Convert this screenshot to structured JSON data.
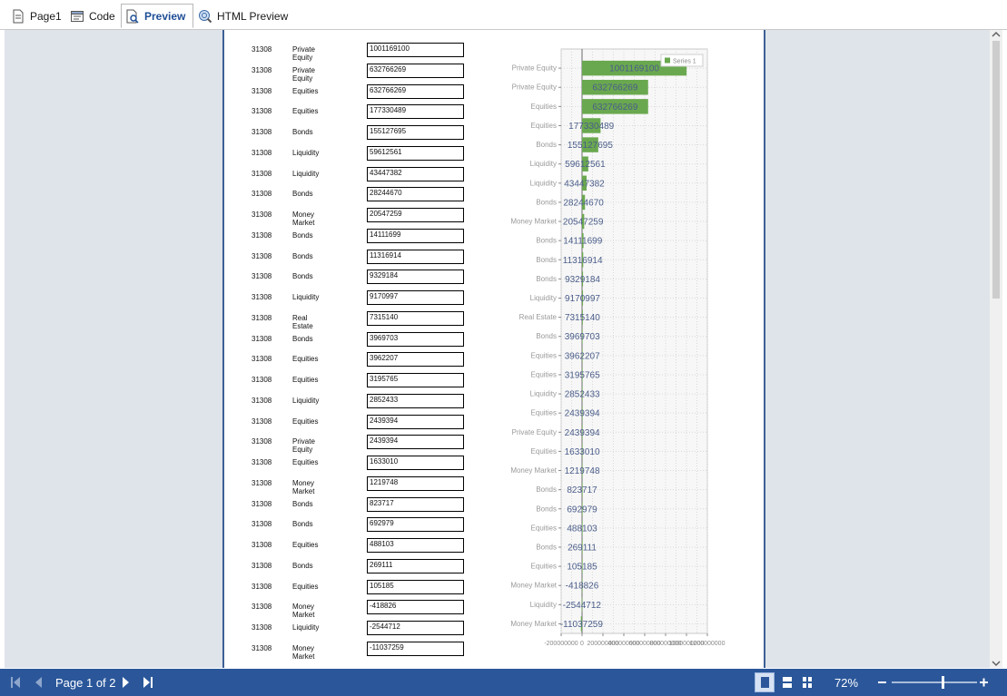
{
  "tabs": [
    {
      "label": "Page1",
      "icon": "page-icon"
    },
    {
      "label": "Code",
      "icon": "code-icon"
    },
    {
      "label": "Preview",
      "icon": "preview-icon",
      "active": true
    },
    {
      "label": "HTML Preview",
      "icon": "html-preview-icon"
    }
  ],
  "report": {
    "rows": [
      {
        "id": "31308",
        "category": "Private Equity",
        "value": "1001169100"
      },
      {
        "id": "31308",
        "category": "Private Equity",
        "value": "632766269"
      },
      {
        "id": "31308",
        "category": "Equities",
        "value": "632766269"
      },
      {
        "id": "31308",
        "category": "Equities",
        "value": "177330489"
      },
      {
        "id": "31308",
        "category": "Bonds",
        "value": "155127695"
      },
      {
        "id": "31308",
        "category": "Liquidity",
        "value": "59612561"
      },
      {
        "id": "31308",
        "category": "Liquidity",
        "value": "43447382"
      },
      {
        "id": "31308",
        "category": "Bonds",
        "value": "28244670"
      },
      {
        "id": "31308",
        "category": "Money Market",
        "value": "20547259"
      },
      {
        "id": "31308",
        "category": "Bonds",
        "value": "14111699"
      },
      {
        "id": "31308",
        "category": "Bonds",
        "value": "11316914"
      },
      {
        "id": "31308",
        "category": "Bonds",
        "value": "9329184"
      },
      {
        "id": "31308",
        "category": "Liquidity",
        "value": "9170997"
      },
      {
        "id": "31308",
        "category": "Real Estate",
        "value": "7315140"
      },
      {
        "id": "31308",
        "category": "Bonds",
        "value": "3969703"
      },
      {
        "id": "31308",
        "category": "Equities",
        "value": "3962207"
      },
      {
        "id": "31308",
        "category": "Equities",
        "value": "3195765"
      },
      {
        "id": "31308",
        "category": "Liquidity",
        "value": "2852433"
      },
      {
        "id": "31308",
        "category": "Equities",
        "value": "2439394"
      },
      {
        "id": "31308",
        "category": "Private Equity",
        "value": "2439394"
      },
      {
        "id": "31308",
        "category": "Equities",
        "value": "1633010"
      },
      {
        "id": "31308",
        "category": "Money Market",
        "value": "1219748"
      },
      {
        "id": "31308",
        "category": "Bonds",
        "value": "823717"
      },
      {
        "id": "31308",
        "category": "Bonds",
        "value": "692979"
      },
      {
        "id": "31308",
        "category": "Equities",
        "value": "488103"
      },
      {
        "id": "31308",
        "category": "Bonds",
        "value": "269111"
      },
      {
        "id": "31308",
        "category": "Equities",
        "value": "105185"
      },
      {
        "id": "31308",
        "category": "Money Market",
        "value": "-418826"
      },
      {
        "id": "31308",
        "category": "Liquidity",
        "value": "-2544712"
      },
      {
        "id": "31308",
        "category": "Money Market",
        "value": "-11037259"
      }
    ]
  },
  "chart_data": {
    "type": "bar",
    "orientation": "horizontal",
    "categories": [
      "Money Market",
      "Liquidity",
      "Money Market",
      "Equities",
      "Bonds",
      "Equities",
      "Bonds",
      "Bonds",
      "Money Market",
      "Equities",
      "Private Equity",
      "Equities",
      "Liquidity",
      "Equities",
      "Equities",
      "Bonds",
      "Real Estate",
      "Liquidity",
      "Bonds",
      "Bonds",
      "Bonds",
      "Money Market",
      "Bonds",
      "Liquidity",
      "Liquidity",
      "Bonds",
      "Equities",
      "Equities",
      "Private Equity",
      "Private Equity"
    ],
    "series": [
      {
        "name": "Series 1",
        "color": "#6aa84f",
        "values": [
          -11037259,
          -2544712,
          -418826,
          105185,
          269111,
          488103,
          692979,
          823717,
          1219748,
          1633010,
          2439394,
          2439394,
          2852433,
          3195765,
          3962207,
          3969703,
          7315140,
          9170997,
          9329184,
          11316914,
          14111699,
          20547259,
          28244670,
          43447382,
          59612561,
          155127695,
          177330489,
          632766269,
          632766269,
          1001169100
        ]
      }
    ],
    "xlim": [
      -200000000,
      1200000000
    ],
    "x_ticks": [
      "-200000000",
      "0",
      "200000000",
      "400000000",
      "600000000",
      "800000000",
      "1000000000",
      "1200000000"
    ],
    "legend": "top-right",
    "grid": true
  },
  "statusbar": {
    "page_label": "Page 1 of 2",
    "zoom": "72%",
    "zoom_fraction": 0.6
  },
  "colors": {
    "accent": "#2b579a",
    "active_tab": "#1f4e96",
    "bar": "#6aa84f"
  }
}
